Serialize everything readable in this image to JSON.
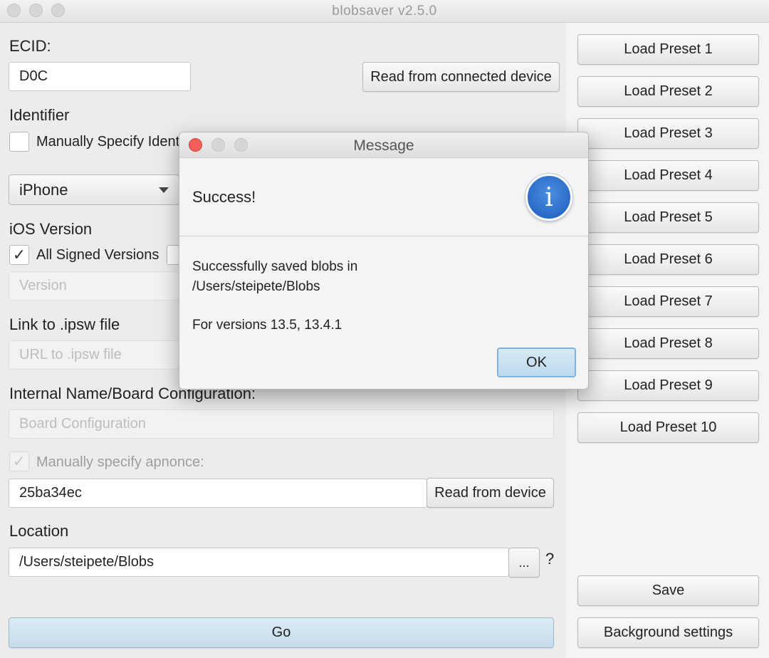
{
  "window": {
    "title": "blobsaver v2.5.0"
  },
  "ecid": {
    "label": "ECID:",
    "value": "D0C",
    "read_button": "Read from connected device"
  },
  "identifier": {
    "label": "Identifier",
    "manual_checkbox_label": "Manually Specify Identi",
    "device_select": "iPhone"
  },
  "ios_version": {
    "label": "iOS Version",
    "all_signed_label": "All Signed Versions",
    "version_placeholder": "Version"
  },
  "ipsw": {
    "label": "Link to .ipsw file",
    "placeholder": "URL to .ipsw file"
  },
  "board": {
    "label": "Internal Name/Board Configuration:",
    "placeholder": "Board Configuration"
  },
  "apnonce": {
    "checkbox_label": "Manually specify apnonce:",
    "value": "25ba34ec",
    "read_button": "Read from device"
  },
  "location": {
    "label": "Location",
    "value": "/Users/steipete/Blobs",
    "browse_button": "...",
    "help": "?"
  },
  "go_button": "Go",
  "presets": [
    "Load Preset 1",
    "Load Preset 2",
    "Load Preset 3",
    "Load Preset 4",
    "Load Preset 5",
    "Load Preset 6",
    "Load Preset 7",
    "Load Preset 8",
    "Load Preset 9",
    "Load Preset 10"
  ],
  "save_button": "Save",
  "background_settings_button": "Background settings",
  "dialog": {
    "title": "Message",
    "header": "Success!",
    "line1": "Successfully saved blobs in",
    "line2": "/Users/steipete/Blobs",
    "line3": "For versions 13.5, 13.4.1",
    "ok_button": "OK",
    "icon": "info-icon"
  },
  "checkmark_glyph": "✓",
  "info_glyph": "i",
  "colors": {
    "close": "#f25f58",
    "info_blue": "#1c5bbd",
    "go_button": "#c4dcea"
  }
}
